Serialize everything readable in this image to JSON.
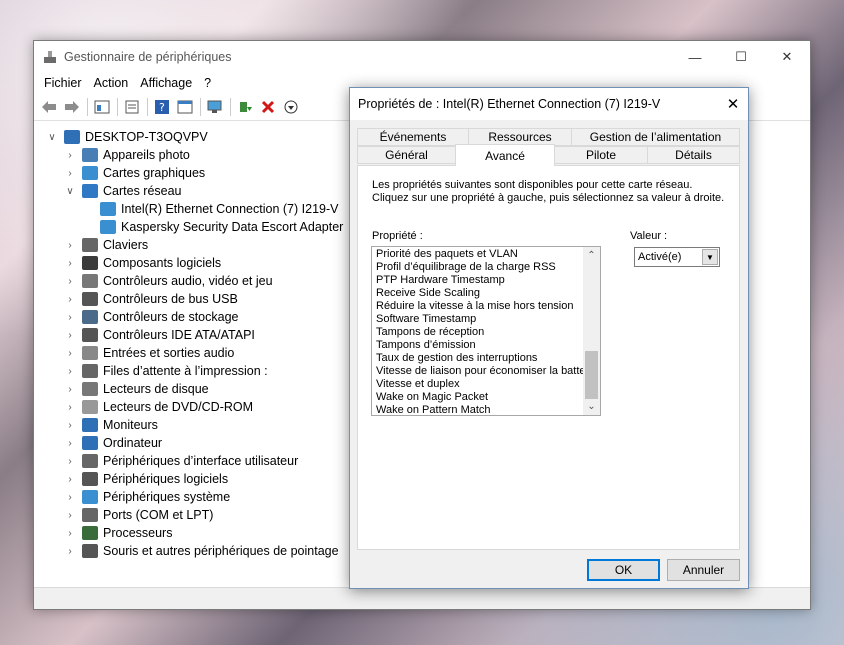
{
  "main_window": {
    "title": "Gestionnaire de périphériques",
    "menu": [
      "Fichier",
      "Action",
      "Affichage",
      "?"
    ],
    "tree": {
      "root": "DESKTOP-T3OQVPV",
      "items": [
        {
          "label": "Appareils photo",
          "icon": "camera-icon"
        },
        {
          "label": "Cartes graphiques",
          "icon": "display-adapter-icon"
        },
        {
          "label": "Cartes réseau",
          "icon": "network-adapter-icon",
          "expanded": true,
          "children": [
            "Intel(R) Ethernet Connection (7) I219-V",
            "Kaspersky Security Data Escort Adapter"
          ]
        },
        {
          "label": "Claviers",
          "icon": "keyboard-icon"
        },
        {
          "label": "Composants logiciels",
          "icon": "software-component-icon"
        },
        {
          "label": "Contrôleurs audio, vidéo et jeu",
          "icon": "speaker-icon"
        },
        {
          "label": "Contrôleurs de bus USB",
          "icon": "usb-icon"
        },
        {
          "label": "Contrôleurs de stockage",
          "icon": "storage-controller-icon"
        },
        {
          "label": "Contrôleurs IDE ATA/ATAPI",
          "icon": "ide-controller-icon"
        },
        {
          "label": "Entrées et sorties audio",
          "icon": "audio-io-icon"
        },
        {
          "label": "Files d’attente à l’impression :",
          "icon": "printer-icon"
        },
        {
          "label": "Lecteurs de disque",
          "icon": "disk-drive-icon"
        },
        {
          "label": "Lecteurs de DVD/CD-ROM",
          "icon": "dvd-icon"
        },
        {
          "label": "Moniteurs",
          "icon": "monitor-icon"
        },
        {
          "label": "Ordinateur",
          "icon": "computer-icon"
        },
        {
          "label": "Périphériques d’interface utilisateur",
          "icon": "hid-icon"
        },
        {
          "label": "Périphériques logiciels",
          "icon": "software-device-icon"
        },
        {
          "label": "Périphériques système",
          "icon": "system-device-icon"
        },
        {
          "label": "Ports (COM et LPT)",
          "icon": "port-icon"
        },
        {
          "label": "Processeurs",
          "icon": "processor-icon"
        },
        {
          "label": "Souris et autres périphériques de pointage",
          "icon": "mouse-icon"
        }
      ]
    }
  },
  "dialog": {
    "title": "Propriétés de : Intel(R) Ethernet Connection (7) I219-V",
    "tabs_back": [
      "Événements",
      "Ressources",
      "Gestion de l’alimentation"
    ],
    "tabs_front": [
      "Général",
      "Avancé",
      "Pilote",
      "Détails"
    ],
    "active_tab": "Avancé",
    "description": "Les propriétés suivantes sont disponibles pour cette carte réseau. Cliquez sur une propriété à gauche, puis sélectionnez sa valeur à droite.",
    "property_label": "Propriété :",
    "value_label": "Valeur :",
    "properties": [
      "Priorité des paquets et VLAN",
      "Profil d’équilibrage de la charge RSS",
      "PTP Hardware Timestamp",
      "Receive Side Scaling",
      "Réduire la vitesse à la mise hors tension",
      "Software Timestamp",
      "Tampons de réception",
      "Tampons d’émission",
      "Taux de gestion des interruptions",
      "Vitesse de liaison pour économiser la batterie",
      "Vitesse et duplex",
      "Wake on Magic Packet",
      "Wake on Pattern Match"
    ],
    "value_selected": "Activé(e)",
    "ok_label": "OK",
    "cancel_label": "Annuler"
  }
}
